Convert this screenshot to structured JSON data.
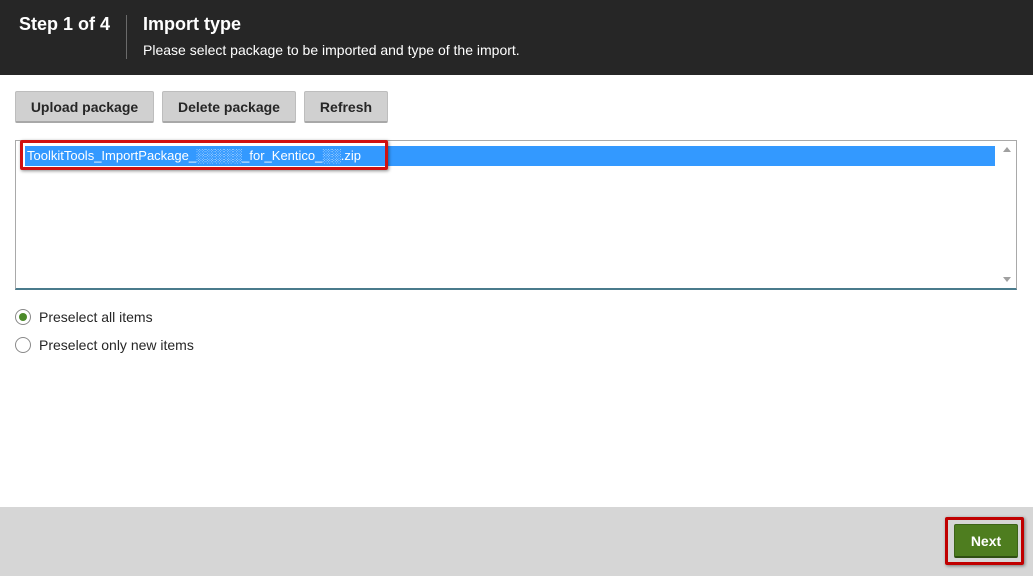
{
  "header": {
    "step": "Step 1 of 4",
    "title": "Import type",
    "subtitle": "Please select package to be imported and type of the import."
  },
  "toolbar": {
    "upload_label": "Upload package",
    "delete_label": "Delete package",
    "refresh_label": "Refresh"
  },
  "package_list": {
    "items": [
      {
        "label": "ToolkitTools_ImportPackage_░░░░░_for_Kentico_░░.zip",
        "selected": true
      }
    ]
  },
  "options": {
    "preselect_all": {
      "label": "Preselect all items",
      "checked": true
    },
    "preselect_new": {
      "label": "Preselect only new items",
      "checked": false
    }
  },
  "footer": {
    "next_label": "Next"
  },
  "colors": {
    "header_bg": "#262626",
    "selection": "#3399ff",
    "highlight_red": "#d01111",
    "next_green": "#4e7d1f",
    "footer_bg": "#d6d6d6"
  }
}
